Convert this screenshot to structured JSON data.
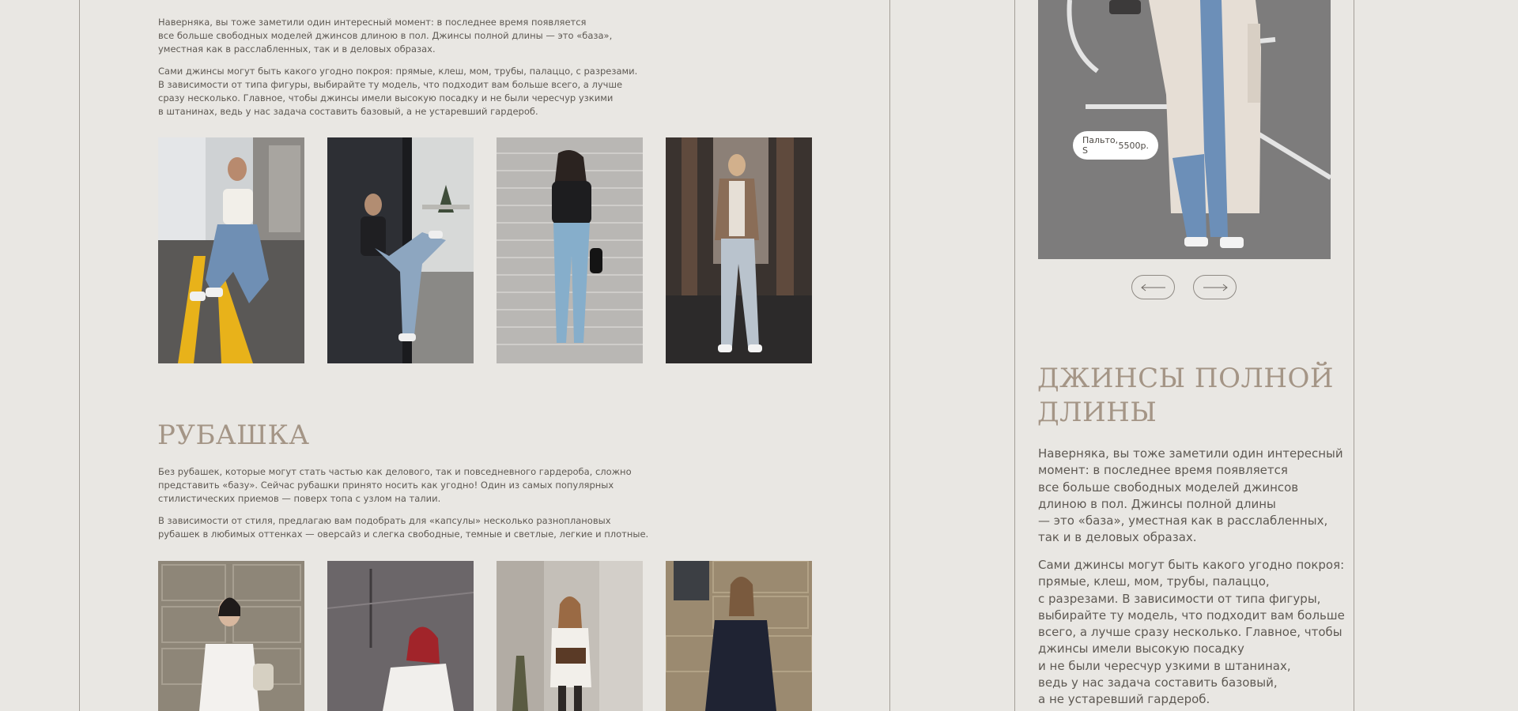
{
  "left": {
    "para1": "Наверняка, вы тоже заметили один интересный момент: в последнее время появляется\nвсе больше свободных моделей джинсов длиною в пол. Джинсы полной длины — это «база»,\nуместная как в расслабленных, так и в деловых образах.",
    "para2": "Сами джинсы могут быть какого угодно покроя: прямые, клеш, мом, трубы, палаццо, с разрезами.\nВ зависимости от типа фигуры, выбирайте ту модель, что подходит вам больше всего, а лучше\nсразу несколько. Главное, чтобы джинсы имели высокую посадку и не были чересчур узкими\nв штанинах, ведь у нас задача составить базовый, а не устаревший гардероб.",
    "shirt_heading": "РУБАШКА",
    "shirt_para1": "Без рубашек, которые могут стать частью как делового, так и повседневного гардероба, сложно\nпредставить «базу». Сейчас рубашки принято носить как угодно! Один из самых популярных\nстилистических приемов — поверх топа с узлом на талии.",
    "shirt_para2": "В зависимости от стиля, предлагаю вам подобрать для «капсулы» несколько разноплановых\nрубашек в любимых оттенках — оверсайз и слегка свободные, темные и светлые, легкие и плотные."
  },
  "right": {
    "tag_item": "Пальто, S",
    "tag_price": "5500р.",
    "prev_label": "previous",
    "next_label": "next",
    "heading": "ДЖИНСЫ ПОЛНОЙ\nДЛИНЫ",
    "para1": "Наверняка, вы тоже заметили один интересный\nмомент: в последнее время появляется\nвсе больше свободных моделей джинсов\nдлиною в пол. Джинсы полной длины\n— это «база», уместная как в расслабленных,\nтак и в деловых образах.",
    "para2": "Сами джинсы могут быть какого угодно покроя:\nпрямые, клеш, мом, трубы, палаццо,\nс разрезами. В зависимости от типа фигуры,\nвыбирайте ту модель, что подходит вам больше\nвсего, а лучше сразу несколько. Главное, чтобы\nджинсы имели высокую посадку\nи не были чересчур узкими в штанинах,\nведь у нас задача составить базовый,\nа не устаревший гардероб."
  }
}
